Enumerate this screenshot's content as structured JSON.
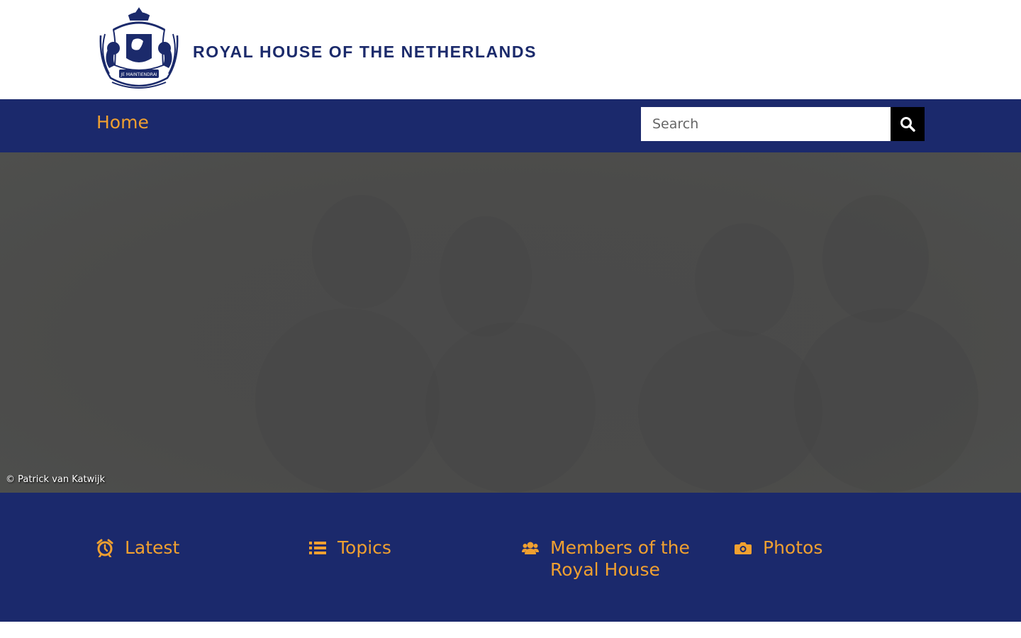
{
  "header": {
    "title": "ROYAL HOUSE OF THE NETHERLANDS",
    "logo_icon": "royal-coat-of-arms",
    "logo_motto": "JE MAINTIENDRAI"
  },
  "nav": {
    "home_label": "Home"
  },
  "search": {
    "placeholder": "Search",
    "button_icon": "search-icon"
  },
  "hero": {
    "credit": "© Patrick van Katwijk"
  },
  "quicklinks": [
    {
      "label": "Latest",
      "icon": "alarm-clock-icon"
    },
    {
      "label": "Topics",
      "icon": "list-icon"
    },
    {
      "label": "Members of the Royal House",
      "icon": "users-icon"
    },
    {
      "label": "Photos",
      "icon": "camera-icon"
    }
  ],
  "colors": {
    "brand_blue": "#1b296c",
    "accent_orange": "#f0a030",
    "hero_grey": "#4a4a4a",
    "white": "#ffffff",
    "black": "#000000"
  }
}
